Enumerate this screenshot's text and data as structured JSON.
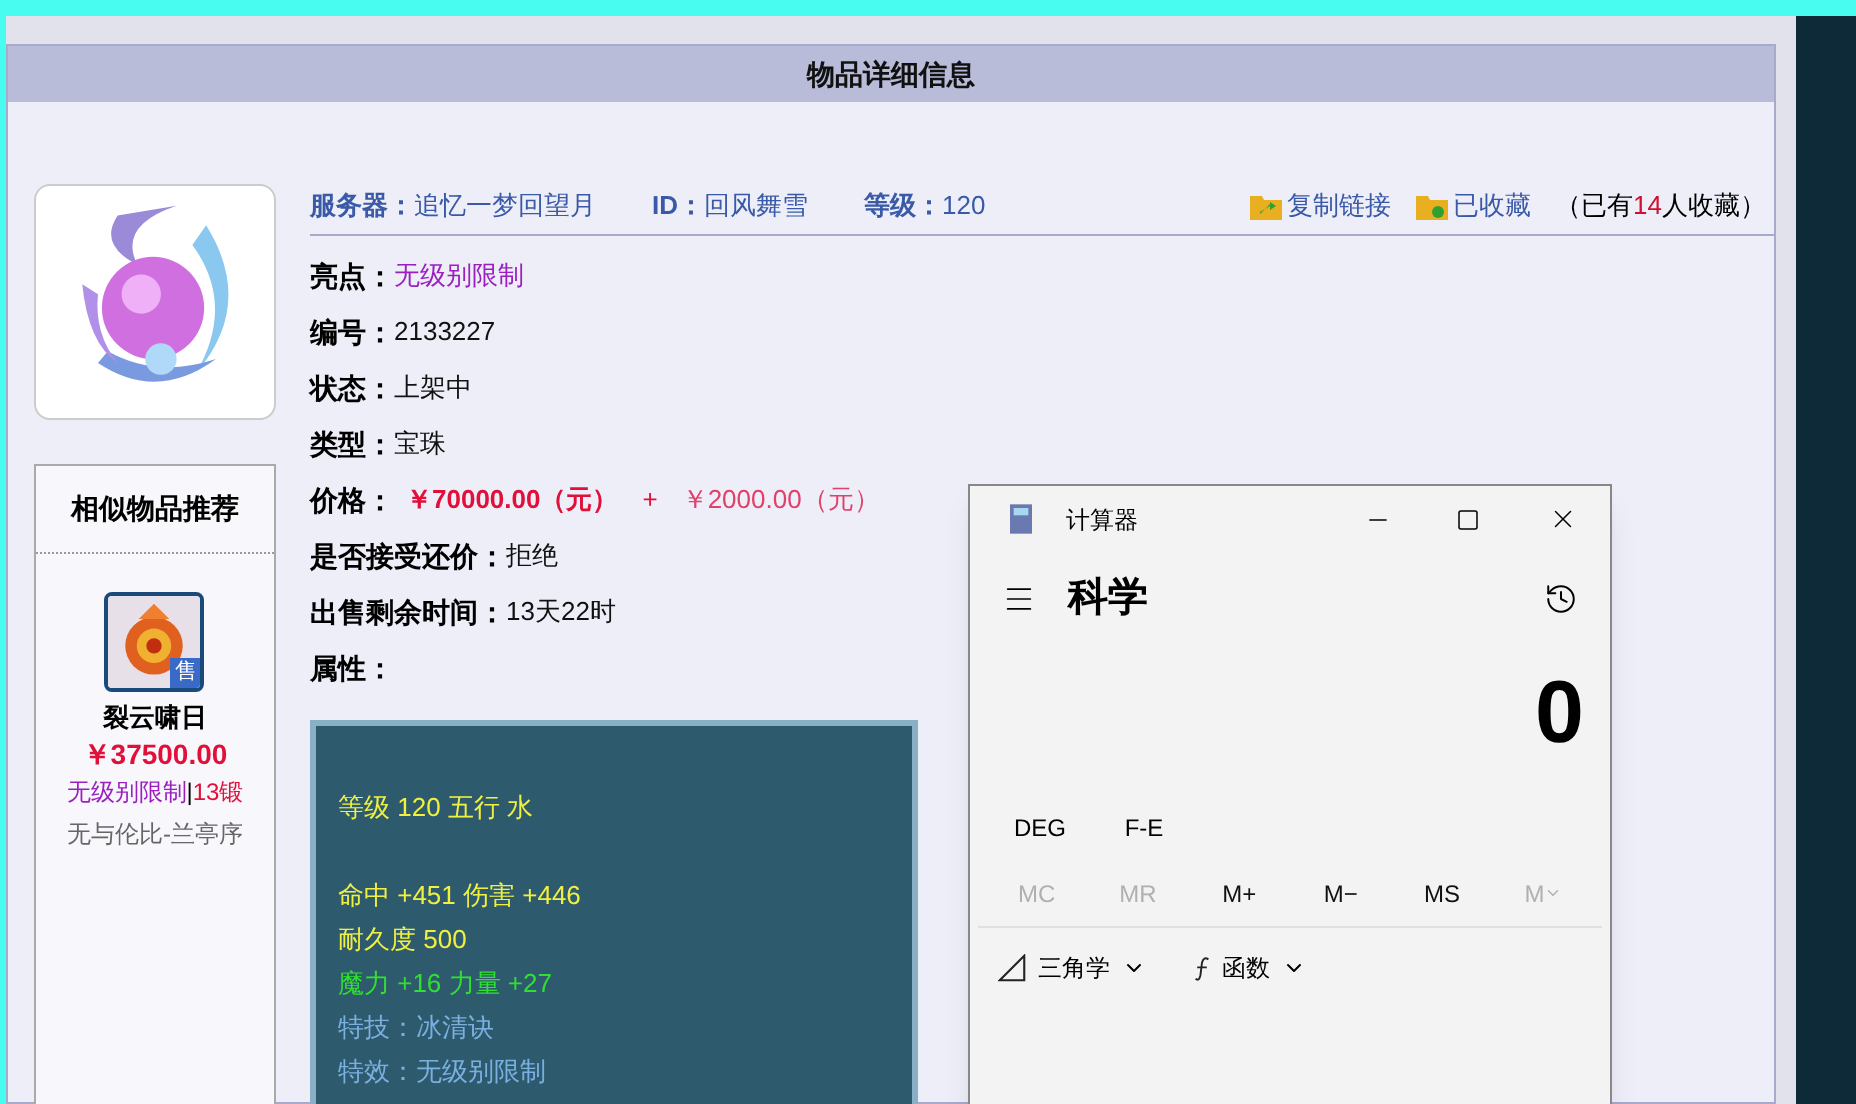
{
  "page": {
    "title": "物品详细信息"
  },
  "item": {
    "server_label": "服务器：",
    "server": "追忆一梦回望月",
    "id_label": "ID：",
    "id": "回风舞雪",
    "level_label": "等级：",
    "level": "120",
    "actions": [
      {
        "kind": "copy",
        "label": "复制链接"
      },
      {
        "kind": "fav",
        "label": "已收藏"
      }
    ],
    "fav_count": {
      "before": "（已有",
      "count": "14",
      "after": "人收藏）"
    },
    "fields": [
      {
        "label": "亮点：",
        "value": "无级别限制",
        "kind": "highlight"
      },
      {
        "label": "编号：",
        "value": "2133227",
        "kind": "plain"
      },
      {
        "label": "状态：",
        "value": "上架中",
        "kind": "plain"
      },
      {
        "label": "类型：",
        "value": "宝珠",
        "kind": "plain"
      },
      {
        "label": "价格：",
        "kind": "price",
        "prices": [
          "￥70000.00（元）",
          "￥2000.00（元）"
        ],
        "plus": "+"
      },
      {
        "label": "是否接受还价：",
        "value": "拒绝",
        "kind": "plain"
      },
      {
        "label": "出售剩余时间：",
        "value": "13天22时",
        "kind": "plain"
      },
      {
        "label": "属性：",
        "kind": "plain"
      }
    ],
    "attributes": [
      {
        "text": "等级 120 五行 水",
        "kind": "base"
      },
      {
        "text": "命中 +451 伤害 +446",
        "kind": "base"
      },
      {
        "text": "耐久度 500",
        "kind": "base"
      },
      {
        "text": "魔力 +16 力量 +27",
        "kind": "bonus"
      },
      {
        "text": "特技：冰清诀",
        "kind": "skill"
      },
      {
        "text": "特效：无级别限制",
        "kind": "skill"
      }
    ]
  },
  "similar": {
    "title": "相似物品推荐",
    "items": [
      {
        "name": "裂云啸日",
        "badge": "售",
        "price": "￥37500.00",
        "tag": "无级别限制",
        "sep": "|",
        "forge": "13锻",
        "seller": "无与伦比-兰亭序"
      }
    ]
  },
  "calculator": {
    "title": "计算器",
    "mode": "科学",
    "display": "0",
    "mode_buttons": [
      "DEG",
      "F-E"
    ],
    "memory": [
      {
        "label": "MC",
        "disabled": true
      },
      {
        "label": "MR",
        "disabled": true
      },
      {
        "label": "M+",
        "disabled": false
      },
      {
        "label": "M−",
        "disabled": false
      },
      {
        "label": "MS",
        "disabled": false
      },
      {
        "label": "M",
        "disabled": true,
        "kind": "menu"
      }
    ],
    "menus": [
      {
        "kind": "trig",
        "label": "三角学"
      },
      {
        "kind": "func",
        "label": "函数"
      }
    ]
  }
}
